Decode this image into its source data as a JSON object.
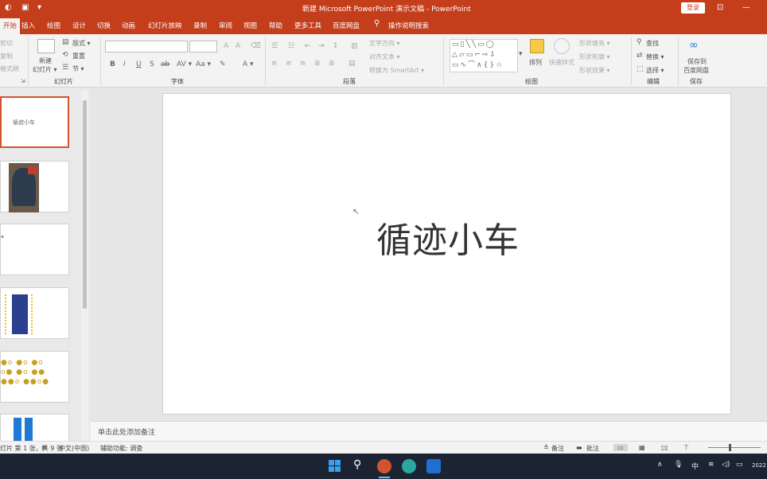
{
  "titlebar": {
    "title": "新建 Microsoft PowerPoint 演示文稿 - PowerPoint",
    "login": "登录"
  },
  "tabs": [
    "开始",
    "插入",
    "绘图",
    "设计",
    "切换",
    "动画",
    "幻灯片放映",
    "录制",
    "审阅",
    "视图",
    "帮助",
    "更多工具",
    "百度网盘"
  ],
  "tell_me": "操作说明搜索",
  "ribbon": {
    "groups": {
      "slides": "幻灯片",
      "font": "字体",
      "paragraph": "段落",
      "drawing": "绘图",
      "editing": "编辑",
      "save": "保存"
    },
    "clipboard_items": [
      "剪切",
      "复制",
      "格式刷"
    ],
    "new_slide": "新建",
    "new_slide_sub": "幻灯片 ▾",
    "layout": "版式 ▾",
    "reset": "重置",
    "section": "节 ▾",
    "text_direction": "文字方向 ▾",
    "align_text": "对齐文本 ▾",
    "smartart": "转换为 SmartArt ▾",
    "arrange": "排列",
    "quick_styles": "快速样式",
    "shape_fill": "形状填充 ▾",
    "shape_outline": "形状轮廓 ▾",
    "shape_effects": "形状效果 ▾",
    "find": "查找",
    "replace": "替换 ▾",
    "select": "选择 ▾",
    "save_to": "保存到",
    "baidu": "百度网盘",
    "font_buttons": [
      "B",
      "I",
      "U",
      "S",
      "ab",
      "AV ▾",
      "Aa ▾",
      "A ▾"
    ]
  },
  "thumbnails": [
    {
      "caption": "循迹小车",
      "selected": true
    },
    {
      "caption": "",
      "selected": false
    },
    {
      "caption": "",
      "selected": false
    },
    {
      "caption": "",
      "selected": false
    },
    {
      "caption": "",
      "selected": false
    },
    {
      "caption": "",
      "selected": false
    }
  ],
  "slide": {
    "title": "循迹小车"
  },
  "notes_placeholder": "单击此处添加备注",
  "status": {
    "slide_count": "灯片 第 1 张，共 9 张",
    "language": "中文(中国)",
    "accessibility": "辅助功能: 调查",
    "notes_btn": "备注",
    "comments_btn": "批注"
  },
  "taskbar": {
    "ime": "中",
    "clock": "2022"
  },
  "colors": {
    "accent": "#c43e1c",
    "selected_border": "#d35230",
    "taskbar": "#1c2434"
  }
}
